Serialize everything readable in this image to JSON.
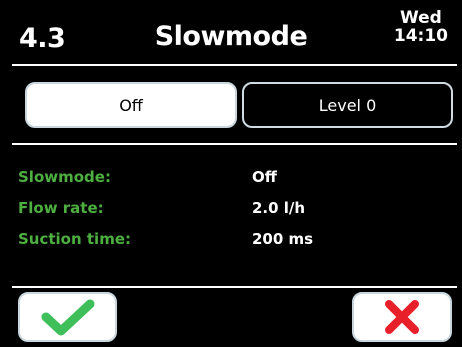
{
  "header": {
    "menu_number": "4.3",
    "title": "Slowmode",
    "day": "Wed",
    "time": "14:10"
  },
  "mode_selector": {
    "options": [
      {
        "label": "Off",
        "selected": true
      },
      {
        "label": "Level 0",
        "selected": false
      }
    ]
  },
  "info": [
    {
      "label": "Slowmode:",
      "value": "Off"
    },
    {
      "label": "Flow rate:",
      "value": "2.0 l/h"
    },
    {
      "label": "Suction time:",
      "value": "200 ms"
    }
  ],
  "actions": {
    "confirm_icon": "checkmark-icon",
    "cancel_icon": "cross-icon"
  },
  "colors": {
    "background": "#000000",
    "label_green": "#4caf3f",
    "confirm_green": "#3fbf5a",
    "cancel_red": "#e8202a",
    "button_white": "#ffffff"
  }
}
